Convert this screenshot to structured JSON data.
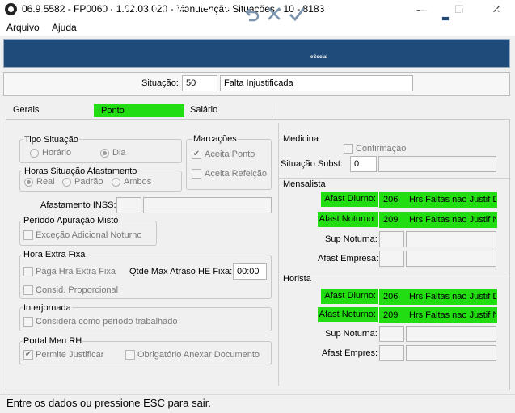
{
  "window": {
    "title": "06.9.5582 - FP0060 - 1.02.03.020 - Manutenção Situações - 10 - 8183",
    "minimize": "—",
    "maximize": "☐",
    "close": "✕"
  },
  "menu": {
    "file": "Arquivo",
    "help": "Ajuda"
  },
  "toolbar": {
    "esocial_label": "eSocial"
  },
  "header": {
    "situacao_label": "Situação:",
    "situacao_code": "50",
    "situacao_desc": "Falta Injustificada"
  },
  "tabs": {
    "gerais": "Gerais",
    "ponto": "Ponto",
    "salario": "Salário"
  },
  "tipo_situacao": {
    "title": "Tipo Situação",
    "horario": "Horário",
    "dia": "Dia",
    "selected": "Dia"
  },
  "horas_situacao": {
    "title": "Horas Situação Afastamento",
    "real": "Real",
    "padrao": "Padrão",
    "ambos": "Ambos",
    "selected": "Real"
  },
  "marcacoes": {
    "title": "Marcações",
    "aceita_ponto": "Aceita Ponto",
    "aceita_ponto_checked": true,
    "aceita_refeicao": "Aceita Refeição",
    "aceita_refeicao_checked": false
  },
  "afastamento_inss": {
    "label": "Afastamento INSS:"
  },
  "periodo_apuracao": {
    "title": "Período Apuração Misto",
    "excecao": "Exceção Adicional Noturno"
  },
  "hora_extra": {
    "title": "Hora Extra Fixa",
    "paga": "Paga Hra Extra Fixa",
    "consid": "Consid. Proporcional",
    "qtde_label": "Qtde Max Atraso HE Fixa:",
    "qtde_value": "00:00"
  },
  "interjornada": {
    "title": "Interjornada",
    "considera": "Considera como período trabalhado"
  },
  "portal_rh": {
    "title": "Portal Meu RH",
    "permite": "Permite Justificar",
    "permite_checked": true,
    "obrigatorio": "Obrigatório Anexar Documento"
  },
  "medicina": {
    "title": "Medicina",
    "confirmacao": "Confirmação",
    "subst_label": "Situação Subst:",
    "subst_value": "0"
  },
  "mensalista": {
    "title": "Mensalista",
    "afast_diurno_label": "Afast Diurno:",
    "afast_diurno_code": "206",
    "afast_diurno_desc": "Hrs Faltas nao Justif D",
    "afast_noturno_label": "Afast Noturno:",
    "afast_noturno_code": "209",
    "afast_noturno_desc": "Hrs Faltas nao Justif N",
    "sup_noturna_label": "Sup Noturna:",
    "afast_empresa_label": "Afast Empresa:"
  },
  "horista": {
    "title": "Horista",
    "afast_diurno_label": "Afast Diurno:",
    "afast_diurno_code": "206",
    "afast_diurno_desc": "Hrs Faltas nao Justif D",
    "afast_noturno_label": "Afast Noturno:",
    "afast_noturno_code": "209",
    "afast_noturno_desc": "Hrs Faltas nao Justif N",
    "sup_noturna_label": "Sup Noturna:",
    "afast_empres_label": "Afast Empres:"
  },
  "status": {
    "text": "Entre os dados ou pressione ESC para sair."
  },
  "colors": {
    "toolbar_bg": "#1e4b7a",
    "highlight": "#22dd11"
  }
}
